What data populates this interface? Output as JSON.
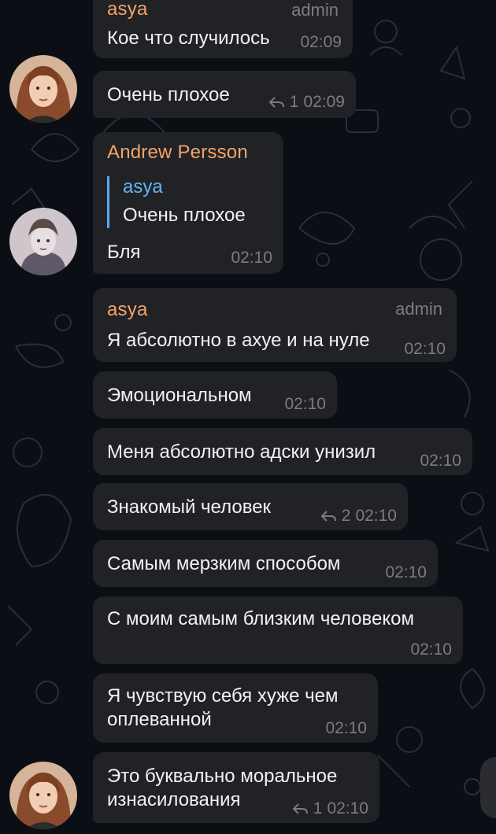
{
  "colors": {
    "background": "#0b0e14",
    "bubble": "#212226",
    "sender_name": "#f3a46a",
    "quote_accent": "#5aa9ee",
    "meta_text": "#7a7c82"
  },
  "messages": [
    {
      "id": "m1",
      "sender": "asya",
      "badge": "admin",
      "text": "Кое что случилось",
      "time": "02:09"
    },
    {
      "id": "m2",
      "text": "Очень плохое",
      "replies": "1",
      "time": "02:09"
    },
    {
      "id": "m3",
      "sender": "Andrew Persson",
      "quote": {
        "name": "asya",
        "text": "Очень плохое"
      },
      "text": "Бля",
      "time": "02:10"
    },
    {
      "id": "m4",
      "sender": "asya",
      "badge": "admin",
      "text": "Я абсолютно в ахуе и на нуле",
      "time": "02:10"
    },
    {
      "id": "m5",
      "text": "Эмоциональном",
      "time": "02:10"
    },
    {
      "id": "m6",
      "text": "Меня абсолютно адски унизил",
      "time": "02:10"
    },
    {
      "id": "m7",
      "text": "Знакомый человек",
      "replies": "2",
      "time": "02:10"
    },
    {
      "id": "m8",
      "text": "Самым мерзким способом",
      "time": "02:10"
    },
    {
      "id": "m9",
      "text": "С моим самым близким человеком",
      "time": "02:10"
    },
    {
      "id": "m10",
      "text_lines": [
        "Я чувствую себя хуже чем",
        "оплеванной"
      ],
      "time": "02:10"
    },
    {
      "id": "m11",
      "text_lines": [
        "Это буквально моральное",
        "изнасилования"
      ],
      "replies": "1",
      "time": "02:10"
    }
  ],
  "avatars": [
    {
      "user": "asya",
      "icon": "woman-avatar"
    },
    {
      "user": "Andrew Persson",
      "icon": "sketch-avatar"
    },
    {
      "user": "asya",
      "icon": "woman-avatar"
    }
  ]
}
